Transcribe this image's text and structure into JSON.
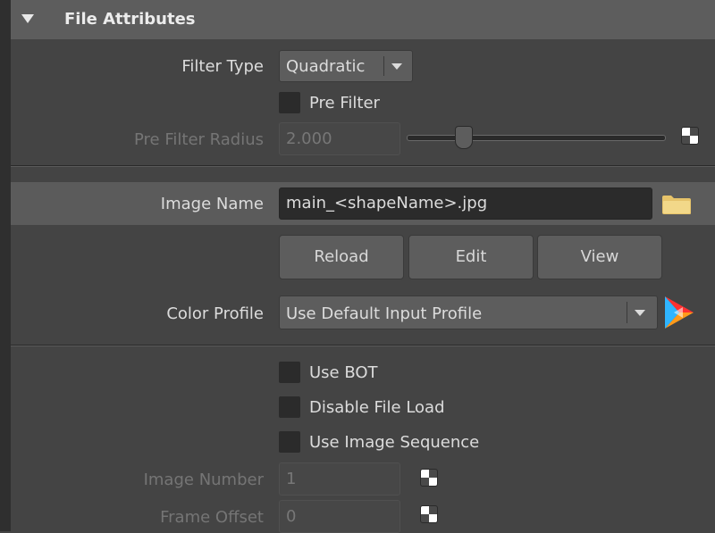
{
  "header": {
    "title": "File Attributes",
    "collapse_icon": "triangle-down-icon"
  },
  "filter": {
    "type_label": "Filter Type",
    "type_value": "Quadratic",
    "pre_filter_label": "Pre Filter",
    "radius_label": "Pre Filter Radius",
    "radius_value": "2.000",
    "radius_slider_fraction": 0.2
  },
  "image": {
    "name_label": "Image Name",
    "name_value": "main_<shapeName>.jpg",
    "folder_icon": "folder-icon",
    "buttons": {
      "reload": "Reload",
      "edit": "Edit",
      "view": "View"
    }
  },
  "color": {
    "profile_label": "Color Profile",
    "profile_value": "Use Default Input Profile",
    "color_icon": "color-wheel-icon"
  },
  "options": {
    "use_bot": "Use BOT",
    "disable_file_load": "Disable File Load",
    "use_image_sequence": "Use Image Sequence"
  },
  "sequence": {
    "image_number_label": "Image Number",
    "image_number_value": "1",
    "frame_offset_label": "Frame Offset",
    "frame_offset_value": "0"
  }
}
